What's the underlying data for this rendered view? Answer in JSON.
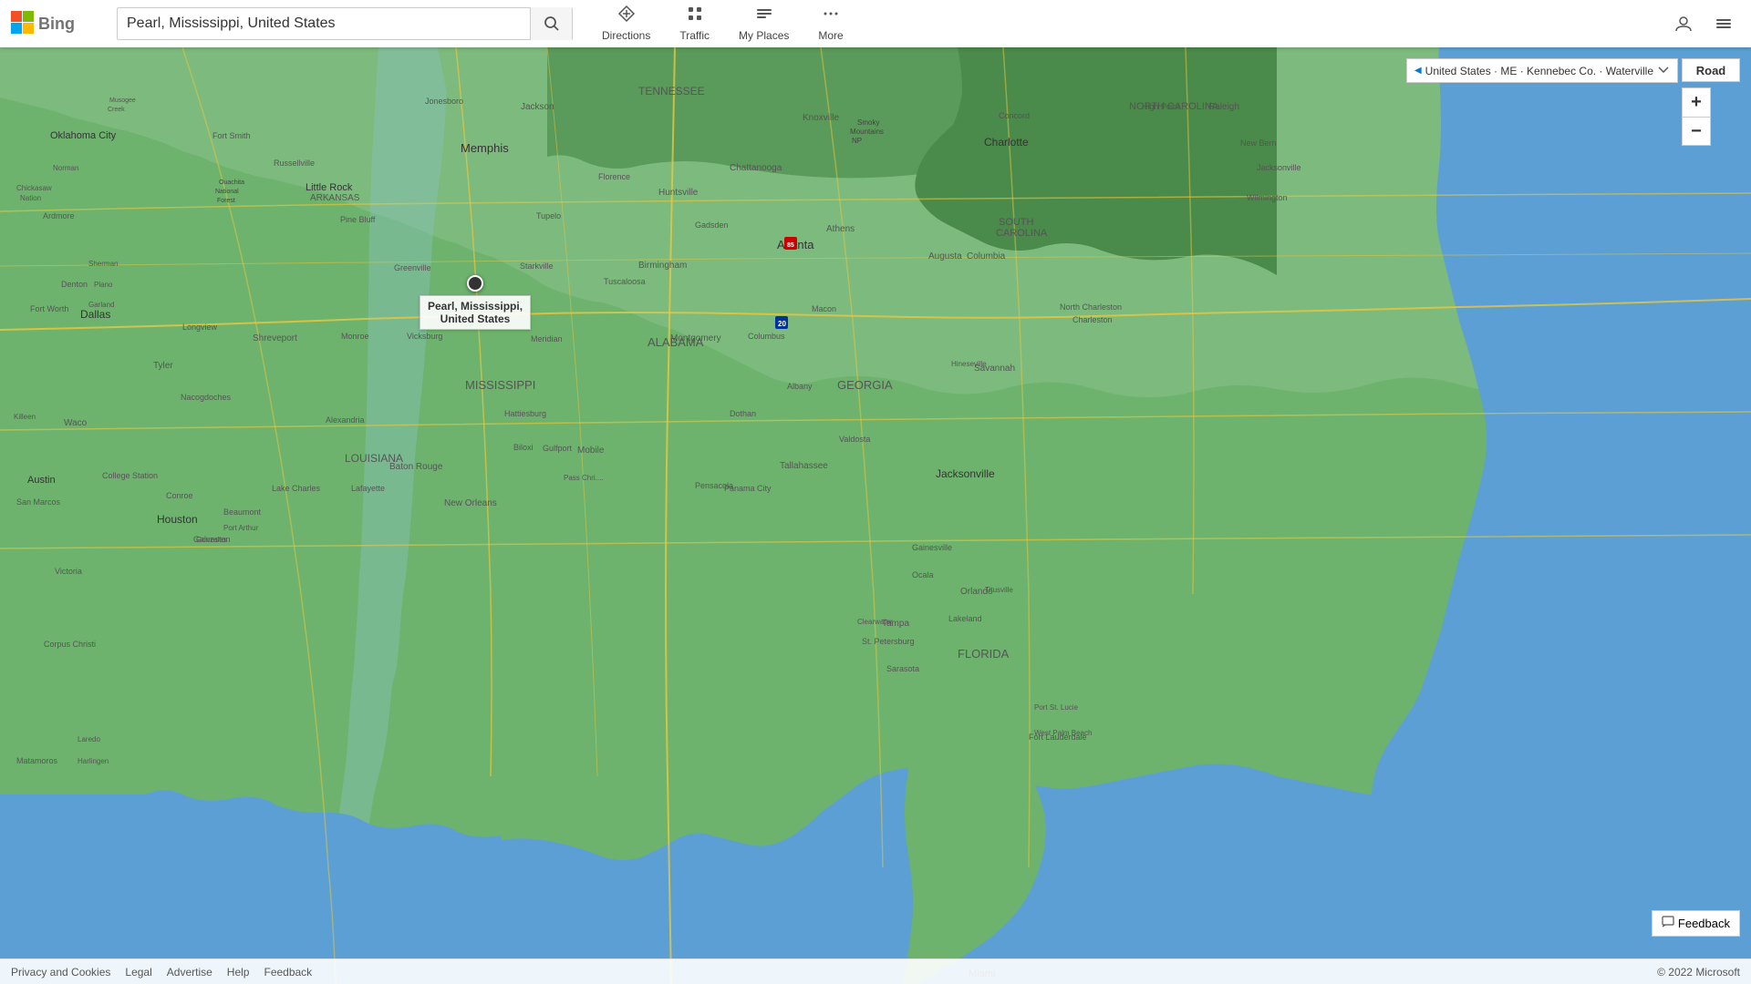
{
  "header": {
    "logo_alt": "Microsoft Bing",
    "search_value": "Pearl, Mississippi, United States",
    "search_placeholder": "Search",
    "nav_items": [
      {
        "id": "directions",
        "label": "Directions",
        "icon": "⬡"
      },
      {
        "id": "traffic",
        "label": "Traffic",
        "icon": "≋"
      },
      {
        "id": "my_places",
        "label": "My Places",
        "icon": "☰"
      },
      {
        "id": "more",
        "label": "More",
        "icon": "•••"
      }
    ]
  },
  "map": {
    "pin_label_line1": "Pearl, Mississippi,",
    "pin_label_line2": "United States",
    "road_btn": "Road",
    "zoom_in": "+",
    "zoom_out": "−",
    "location_breadcrumb": "United States · ME · Kennebec Co. · Waterville",
    "back_arrow": "◀"
  },
  "feedback": {
    "btn_label": "Feedback",
    "icon": "✉"
  },
  "footer": {
    "links": [
      {
        "label": "Privacy and Cookies"
      },
      {
        "label": "Legal"
      },
      {
        "label": "Advertise"
      },
      {
        "label": "Help"
      },
      {
        "label": "Feedback"
      }
    ],
    "copyright": "© 2022 Microsoft"
  }
}
